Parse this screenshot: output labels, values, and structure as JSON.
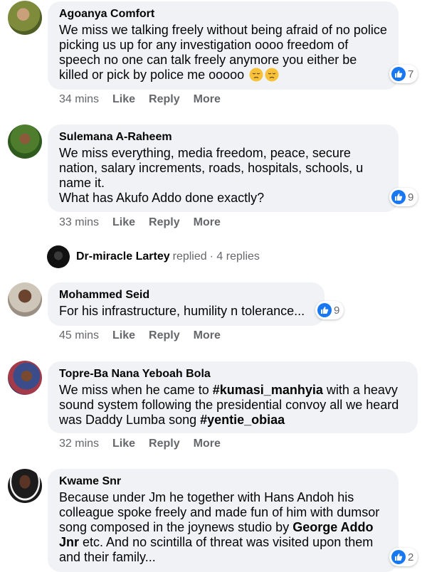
{
  "comments": [
    {
      "author": "Agoanya Comfort",
      "text": "We miss we talking freely without being afraid of no police picking us up for any investigation oooo freedom of speech no one can talk freely anymore you either be killed or pick by police me ooooo",
      "emojis": [
        "pensive-face",
        "pensive-face"
      ],
      "reaction_count": "7",
      "time": "34 mins",
      "actions": [
        "Like",
        "Reply",
        "More"
      ]
    },
    {
      "author": "Sulemana A-Raheem",
      "text_line1": "We miss everything, media freedom, peace, secure nation, salary increments, roads, hospitals, schools, u name it.",
      "text_line2": "What has Akufo Addo done exactly?",
      "reaction_count": "9",
      "time": "33 mins",
      "actions": [
        "Like",
        "Reply",
        "More"
      ]
    },
    {
      "author": "Mohammed Seid",
      "text": "For his infrastructure, humility n tolerance...",
      "reaction_count": "9",
      "time": "45 mins",
      "actions": [
        "Like",
        "Reply",
        "More"
      ]
    },
    {
      "author": "Topre-Ba Nana Yeboah Bola",
      "text_a": "We miss when he came to ",
      "tag1": "#kumasi_manhyia",
      "text_b": " with a heavy sound system following the presidential convoy all we heard was Daddy Lumba song ",
      "tag2": "#yentie_obiaa",
      "time": "32 mins",
      "actions": [
        "Like",
        "Reply",
        "More"
      ]
    },
    {
      "author": "Kwame Snr",
      "text_a": "Because under Jm he together with Hans Andoh his colleague spoke freely and made fun of him with dumsor song composed in the joynews studio by ",
      "bold": "George Addo Jnr",
      "text_b": " etc. And no scintilla of threat was visited upon them and their family...",
      "reaction_count": "2"
    }
  ],
  "replied": {
    "name": "Dr-miracle Lartey",
    "verb": "replied",
    "count": "· 4 replies"
  },
  "colors": {
    "bubble": "#f0f2f5",
    "like_blue": "#1877f2",
    "secondary_text": "#65676b"
  }
}
